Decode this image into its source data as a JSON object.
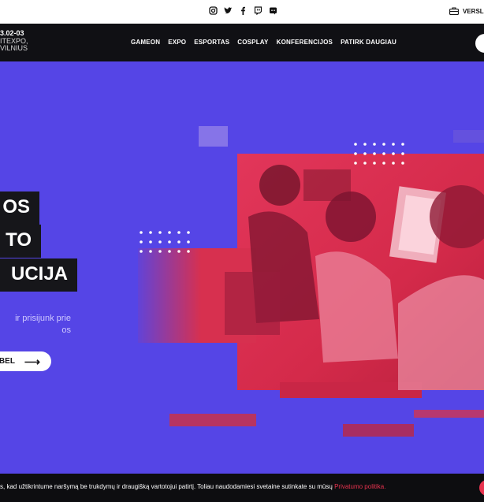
{
  "topbar": {
    "social_icons": [
      "instagram-icon",
      "twitter-icon",
      "facebook-icon",
      "twitch-icon",
      "discord-icon"
    ],
    "business_label": "VERSLU"
  },
  "navbar": {
    "date": "3.02-03",
    "venue": "ITEXPO,",
    "city": "VILNIUS",
    "items": [
      "GAMEON",
      "EXPO",
      "ESPORTAS",
      "COSPLAY",
      "KONFERENCIJOS",
      "PATIRK DAUGIAU"
    ]
  },
  "hero": {
    "headline": [
      "OS",
      "TO",
      "UCIJA"
    ],
    "subtext_line1": "ir prisijunk prie",
    "subtext_line2": "os",
    "cta_label": "BEL",
    "cta_arrow": "⟶"
  },
  "cookie": {
    "text": "s, kad užtikrintume naršymą be trukdymų ir draugišką vartotojui patirtį. Toliau naudodamiesi svetaine sutinkate su mūsų ",
    "link_text": "Privatumo politika."
  },
  "colors": {
    "background": "#5545e6",
    "dark": "#101014",
    "accent": "#e8334f"
  }
}
